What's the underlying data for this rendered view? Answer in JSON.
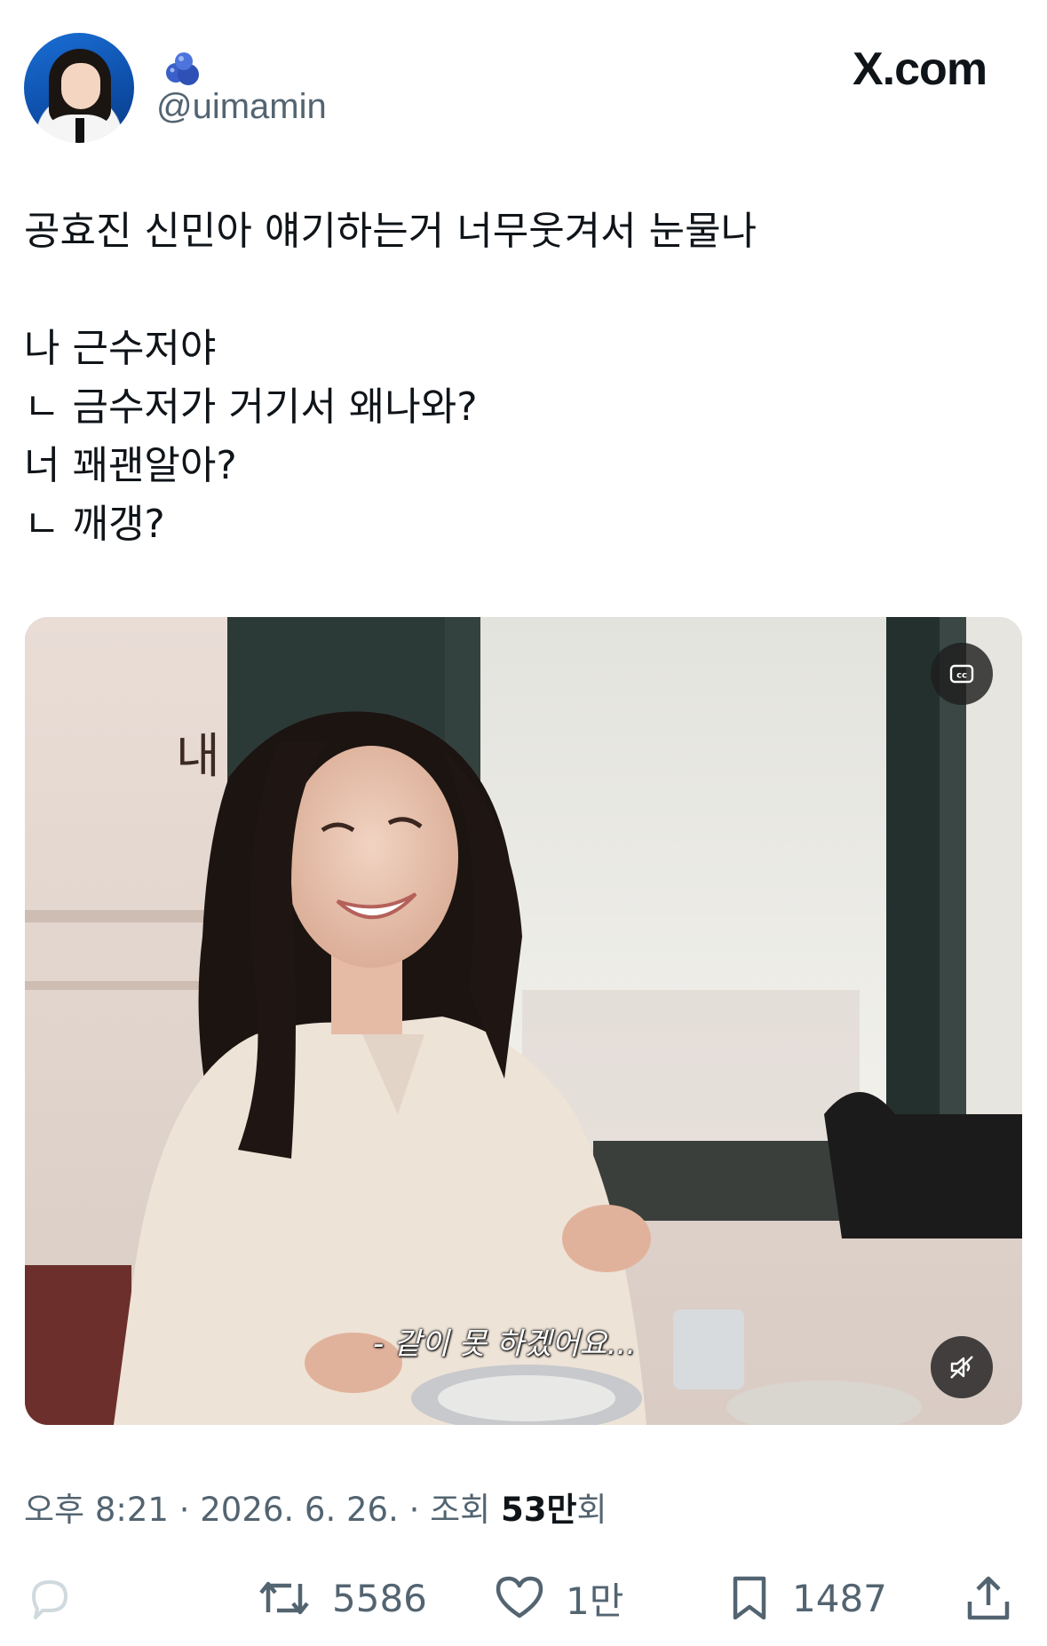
{
  "author": {
    "handle": "@uimamin",
    "avatar": "avatar",
    "badge_icon": "blueberries-icon"
  },
  "site": {
    "logo_text": "X.com"
  },
  "tweet": {
    "lines": [
      "공효진 신민아 얘기하는거 너무웃겨서 눈물나",
      "",
      "나 근수저야",
      "ㄴ 금수저가 거기서 왜나와?",
      "너 꽤괜알아?",
      "ㄴ 깨갱?"
    ]
  },
  "media": {
    "subtitle": "- 같이 못 하겠어요...",
    "sign_text": "내",
    "cc_icon": "cc-icon",
    "mute_icon": "mute-icon"
  },
  "meta": {
    "time": "오후 8:21",
    "sep1": " · ",
    "date": "2026. 6. 26.",
    "sep2": " · ",
    "views_label": "조회 ",
    "views_count": "53만",
    "views_suffix": "회"
  },
  "actions": {
    "reply": {
      "icon": "reply-icon",
      "count": ""
    },
    "retweet": {
      "icon": "retweet-icon",
      "count": "5586"
    },
    "like": {
      "icon": "heart-icon",
      "count": "1만"
    },
    "bookmark": {
      "icon": "bookmark-icon",
      "count": "1487"
    },
    "share": {
      "icon": "share-icon",
      "count": ""
    }
  },
  "colors": {
    "text": "#0f1419",
    "secondary": "#536471",
    "reply_icon": "#cfd9de"
  }
}
